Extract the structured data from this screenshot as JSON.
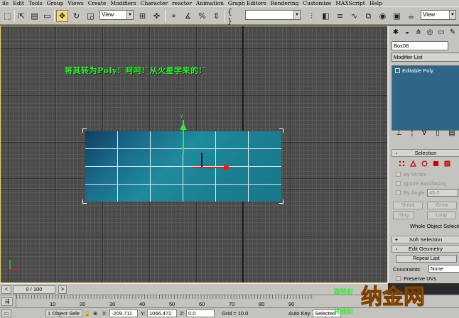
{
  "menu": [
    "ile",
    "Edit",
    "Tools",
    "Group",
    "Views",
    "Create",
    "Modifiers",
    "Character",
    "reactor",
    "Animation",
    "Graph Editors",
    "Rendering",
    "Customize",
    "MAXScript",
    "Help"
  ],
  "toolbar": {
    "ref_coord": "View",
    "ref_coord_right": "View"
  },
  "viewport": {
    "label": "",
    "caption": "将其转为Poly!`呵呵!`从火星学来的!`",
    "gizmo_label": "Y",
    "colors": {
      "caption": "#3ce63c",
      "gizmo_y": "#3fe043",
      "gizmo_x": "#e02020",
      "box": "#1f8b9c"
    }
  },
  "command_panel": {
    "object_name": "Box08",
    "modifier_list": "Modifier List",
    "stack_item": "Editable Poly",
    "selection": {
      "title": "Selection",
      "by_vertex": "By Vertex",
      "ignore_backfacing": "Ignore Backfacing",
      "by_angle": "By Angle:",
      "angle_value": "45.0",
      "shrink": "Shrink",
      "grow": "Grow",
      "ring": "Ring",
      "loop": "Loop",
      "whole_object": "Whole Object Selecte"
    },
    "soft_selection": "Soft Selection",
    "edit_geometry": "Edit Geometry",
    "repeat_last": "Repeat Last",
    "constraints_label": "Constraints:",
    "constraints_value": "None",
    "preserve_uvs": "Preserve UVs"
  },
  "time_slider": {
    "value": "0 / 100",
    "left_btn": "<",
    "right_btn": ">"
  },
  "ruler": {
    "ticks": [
      "10",
      "20",
      "30",
      "40",
      "50",
      "60",
      "70",
      "80",
      "90"
    ]
  },
  "status": {
    "selection": "1 Object Sele",
    "x_label": "X:",
    "x_value": "-209.711",
    "y_label": "Y:",
    "y_value": "1066.472",
    "z_label": "Z:",
    "z_value": "0.0",
    "grid": "Grid = 10.0",
    "auto_key": "Auto Key",
    "selected": "Selected"
  },
  "watermark": {
    "line1": "跟特彩",
    "line2": "将我彩",
    "logo_text": "纳金网"
  }
}
